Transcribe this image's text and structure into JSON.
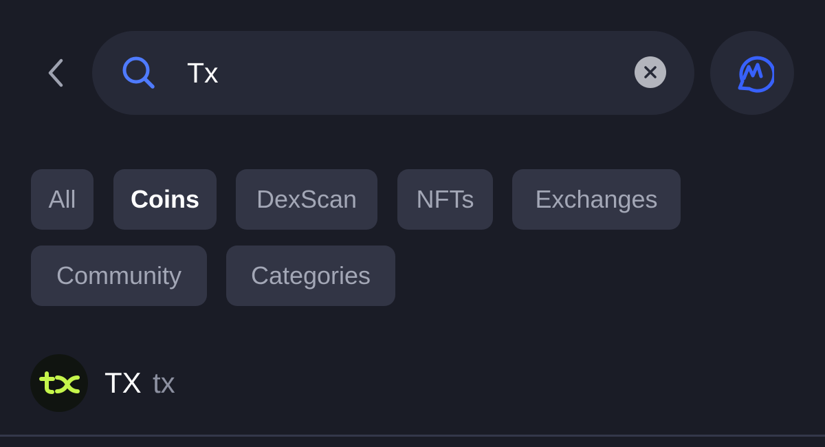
{
  "search": {
    "value": "Tx",
    "icon": "search-icon"
  },
  "icons": {
    "back": "chevron-left-icon",
    "clear": "close-icon",
    "assistant": "coinmarketcap-ai-icon"
  },
  "filters": [
    {
      "label": "All",
      "active": false
    },
    {
      "label": "Coins",
      "active": true
    },
    {
      "label": "DexScan",
      "active": false
    },
    {
      "label": "NFTs",
      "active": false
    },
    {
      "label": "Exchanges",
      "active": false
    },
    {
      "label": "Community",
      "active": false
    },
    {
      "label": "Categories",
      "active": false
    }
  ],
  "results": [
    {
      "name": "TX",
      "symbol": "tx",
      "logo_text": "tx"
    }
  ],
  "colors": {
    "background": "#1a1c26",
    "surface": "#262937",
    "chip": "#323545",
    "accent": "#3861fb",
    "coin_logo": "#c5f54b"
  }
}
